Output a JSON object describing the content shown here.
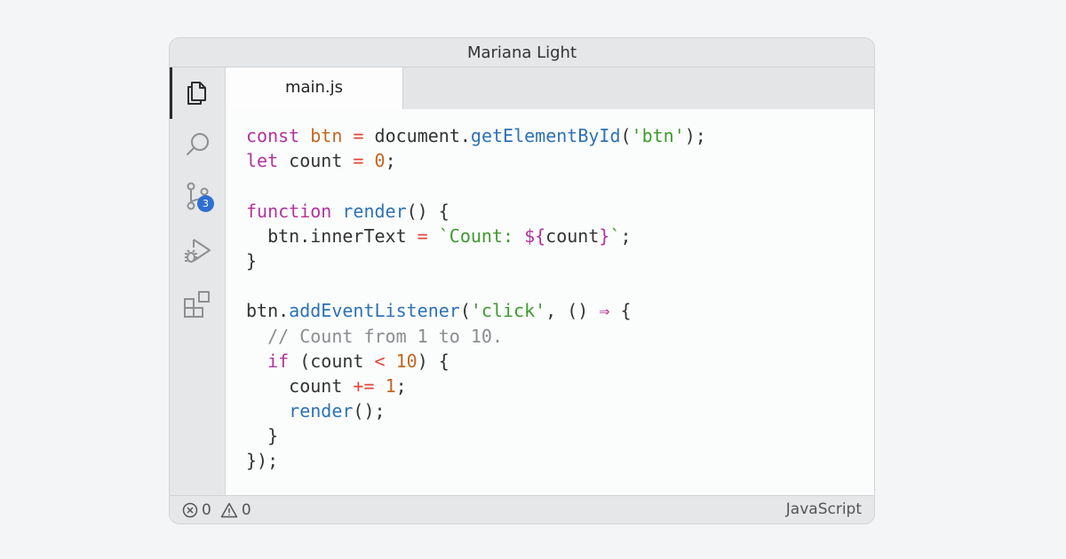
{
  "window": {
    "title": "Mariana Light"
  },
  "activity_bar": {
    "items": [
      {
        "name": "explorer",
        "icon": "files-icon",
        "active": true
      },
      {
        "name": "search",
        "icon": "search-icon"
      },
      {
        "name": "source-control",
        "icon": "source-control-icon",
        "badge": "3"
      },
      {
        "name": "run-debug",
        "icon": "run-debug-icon"
      },
      {
        "name": "extensions",
        "icon": "extensions-icon"
      }
    ]
  },
  "tabs": [
    {
      "label": "main.js",
      "active": true
    }
  ],
  "code": {
    "language": "JavaScript",
    "lines": [
      [
        {
          "t": "const",
          "c": "kw"
        },
        {
          "t": " "
        },
        {
          "t": "btn",
          "c": "var"
        },
        {
          "t": " "
        },
        {
          "t": "=",
          "c": "op"
        },
        {
          "t": " document."
        },
        {
          "t": "getElementById",
          "c": "fn"
        },
        {
          "t": "("
        },
        {
          "t": "'btn'",
          "c": "str"
        },
        {
          "t": ");"
        }
      ],
      [
        {
          "t": "let",
          "c": "kw"
        },
        {
          "t": " count "
        },
        {
          "t": "=",
          "c": "op"
        },
        {
          "t": " "
        },
        {
          "t": "0",
          "c": "num"
        },
        {
          "t": ";"
        }
      ],
      [],
      [
        {
          "t": "function",
          "c": "kw"
        },
        {
          "t": " "
        },
        {
          "t": "render",
          "c": "fn"
        },
        {
          "t": "() {"
        }
      ],
      [
        {
          "t": "  btn.innerText "
        },
        {
          "t": "=",
          "c": "op"
        },
        {
          "t": " "
        },
        {
          "t": "`Count: ",
          "c": "str"
        },
        {
          "t": "${",
          "c": "kw"
        },
        {
          "t": "count"
        },
        {
          "t": "}",
          "c": "kw"
        },
        {
          "t": "`",
          "c": "str"
        },
        {
          "t": ";"
        }
      ],
      [
        {
          "t": "}"
        }
      ],
      [],
      [
        {
          "t": "btn."
        },
        {
          "t": "addEventListener",
          "c": "fn"
        },
        {
          "t": "("
        },
        {
          "t": "'click'",
          "c": "str"
        },
        {
          "t": ", () "
        },
        {
          "t": "⇒",
          "c": "kw"
        },
        {
          "t": " {"
        }
      ],
      [
        {
          "t": "  "
        },
        {
          "t": "// Count from 1 to 10.",
          "c": "com"
        }
      ],
      [
        {
          "t": "  "
        },
        {
          "t": "if",
          "c": "kw"
        },
        {
          "t": " (count "
        },
        {
          "t": "<",
          "c": "op"
        },
        {
          "t": " "
        },
        {
          "t": "10",
          "c": "num"
        },
        {
          "t": ") {"
        }
      ],
      [
        {
          "t": "    count "
        },
        {
          "t": "+=",
          "c": "op"
        },
        {
          "t": " "
        },
        {
          "t": "1",
          "c": "num"
        },
        {
          "t": ";"
        }
      ],
      [
        {
          "t": "    "
        },
        {
          "t": "render",
          "c": "fn"
        },
        {
          "t": "();"
        }
      ],
      [
        {
          "t": "  }"
        }
      ],
      [
        {
          "t": "});"
        }
      ]
    ]
  },
  "status_bar": {
    "errors": "0",
    "warnings": "0",
    "language": "JavaScript"
  },
  "colors": {
    "keyword": "#b3339c",
    "variable": "#c3661f",
    "function": "#2d72b5",
    "string": "#3d9a2e",
    "operator": "#e3463a",
    "comment": "#8a8d90",
    "badge": "#2f6fd0"
  }
}
